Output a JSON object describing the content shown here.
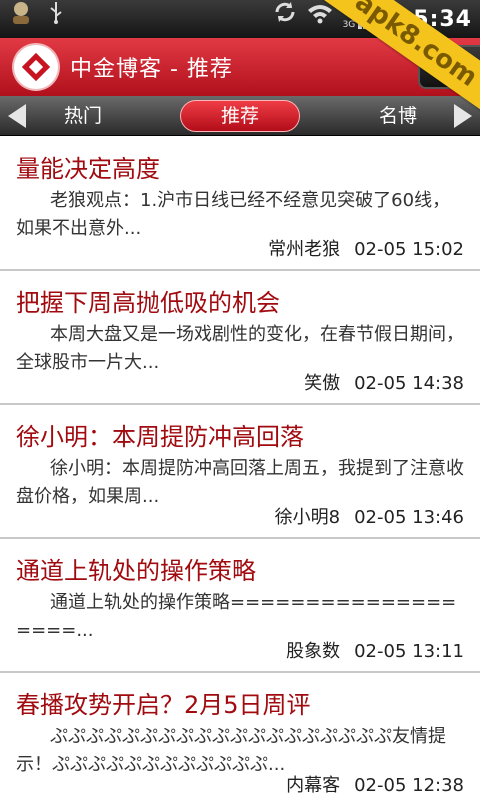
{
  "status_bar": {
    "time": "5:34",
    "network_label": "3G",
    "icons": [
      "avatar-icon",
      "usb-icon",
      "sync-icon",
      "wifi-icon",
      "signal-icon",
      "battery-icon"
    ]
  },
  "watermark": "apk8.com",
  "header": {
    "title": "中金博客 - 推荐"
  },
  "tabs": [
    {
      "label": "热门"
    },
    {
      "label": "推荐",
      "selected": true
    },
    {
      "label": "名博"
    }
  ],
  "colors": {
    "accent_red": "#c81421",
    "title_text": "#a10b10",
    "ribbon": "#f4c41c"
  },
  "articles": [
    {
      "title": "量能决定高度",
      "summary": "老狼观点：1.沪市日线已经不经意见突破了60线，如果不出意外...",
      "author": "常州老狼",
      "time": "02-05 15:02"
    },
    {
      "title": "把握下周高抛低吸的机会",
      "summary": "本周大盘又是一场戏剧性的变化，在春节假日期间，全球股市一片大...",
      "author": "笑傲",
      "time": "02-05 14:38"
    },
    {
      "title": "徐小明：本周提防冲高回落",
      "summary": "徐小明：本周提防冲高回落上周五，我提到了注意收盘价格，如果周...",
      "author": "徐小明8",
      "time": "02-05 13:46"
    },
    {
      "title": "通道上轨处的操作策略",
      "summary": "通道上轨处的操作策略===================...",
      "author": "股象数",
      "time": "02-05 13:11"
    },
    {
      "title": "春播攻势开启？2月5日周评",
      "summary": "ぷぷぷぷぷぷぷぷぷぷぷぷぷぷぷぷぷぷぷ友情提示！ぷぷぷぷぷぷぷぷぷぷぷぷ...",
      "author": "内幕客",
      "time": "02-05 12:38"
    }
  ]
}
